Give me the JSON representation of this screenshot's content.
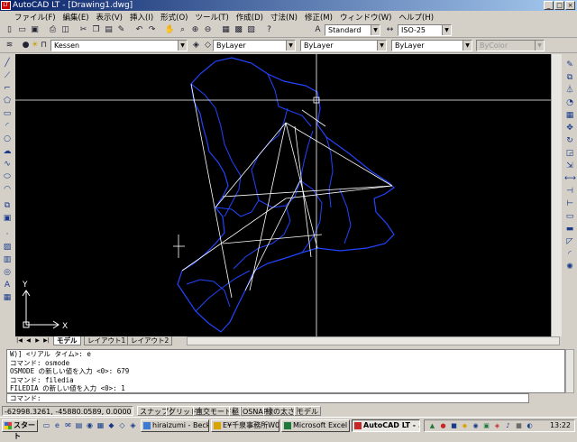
{
  "window": {
    "app_icon": "LT",
    "title": "AutoCAD LT - [Drawing1.dwg]",
    "buttons": [
      "_",
      "□",
      "×"
    ]
  },
  "menu": [
    "ファイル(F)",
    "編集(E)",
    "表示(V)",
    "挿入(I)",
    "形式(O)",
    "ツール(T)",
    "作成(D)",
    "寸法(N)",
    "修正(M)",
    "ウィンドウ(W)",
    "ヘルプ(H)"
  ],
  "toolbar": {
    "text_style": "Standard",
    "dim_style": "ISO-25",
    "layer": "Kessen",
    "color": "ByLayer",
    "linetype": "ByLayer",
    "lineweight": "ByLayer",
    "plot_style": "ByColor"
  },
  "drawing": {
    "ucs_y": "Y",
    "ucs_x": "X"
  },
  "tabs": {
    "nav": [
      "|◀",
      "◀",
      "▶",
      "▶|"
    ],
    "items": [
      "モデル",
      "レイアウト1",
      "レイアウト2"
    ]
  },
  "command_history": [
    "W)] <リアル タイム>: e",
    "コマンド: osmode",
    "OSMODE の新しい値を入力 <0>: 679",
    "コマンド: filedia",
    "FILEDIA の新しい値を入力 <0>: 1"
  ],
  "command_prompt": "コマンド:",
  "status": {
    "coords": "-62998.3261, -45880.0589, 0.0000",
    "buttons": [
      "スナップ",
      "グリッド",
      "直交モード",
      "極",
      "OSNAP",
      "線の太さ",
      "モデル"
    ]
  },
  "taskbar": {
    "start": "スタート",
    "tasks": [
      {
        "label": "hiraizumi - Becky!",
        "color": "#3a7bd5"
      },
      {
        "label": "E¥千泉事務所W0...",
        "color": "#d9a400"
      },
      {
        "label": "Microsoft Excel - ...",
        "color": "#1d7a3a"
      },
      {
        "label": "AutoCAD LT - ...",
        "color": "#c62828"
      }
    ],
    "clock": "13:22"
  },
  "colors": {
    "title_bar": "#0a246a",
    "canvas": "#000000",
    "boundary": "#2244ff",
    "lines": "#ffffff"
  }
}
